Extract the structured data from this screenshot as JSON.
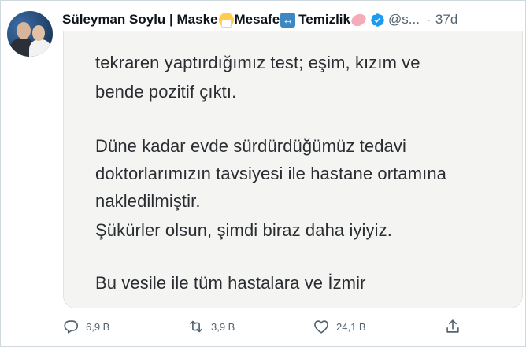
{
  "tweet": {
    "author_name": "Süleyman Soylu | Maske",
    "name_word_2": "Mesafe",
    "name_word_3": "Temizlik",
    "handle": "@s...",
    "separator": "·",
    "time": "37d",
    "body_lines": [
      "tekraren yaptırdığımız test; eşim, kızım ve",
      "bende pozitif çıktı.",
      "Düne kadar evde sürdürdüğümüz tedavi",
      "doktorlarımızın tavsiyesi ile hastane ortamına",
      "nakledilmiştir.",
      "Şükürler olsun, şimdi biraz daha iyiyiz.",
      "Bu vesile ile tüm hastalara ve İzmir"
    ]
  },
  "actions": {
    "reply_count": "6,9 B",
    "retweet_count": "3,9 B",
    "like_count": "24,1 B"
  },
  "colors": {
    "verified_blue": "#1d9bf0",
    "muted_text": "#536471",
    "card_background": "#f4f5f3"
  },
  "icons": [
    "mask-emoji-icon",
    "left-right-arrow-emoji-icon",
    "soap-emoji-icon",
    "verified-badge-icon",
    "reply-icon",
    "retweet-icon",
    "like-icon",
    "share-icon"
  ]
}
